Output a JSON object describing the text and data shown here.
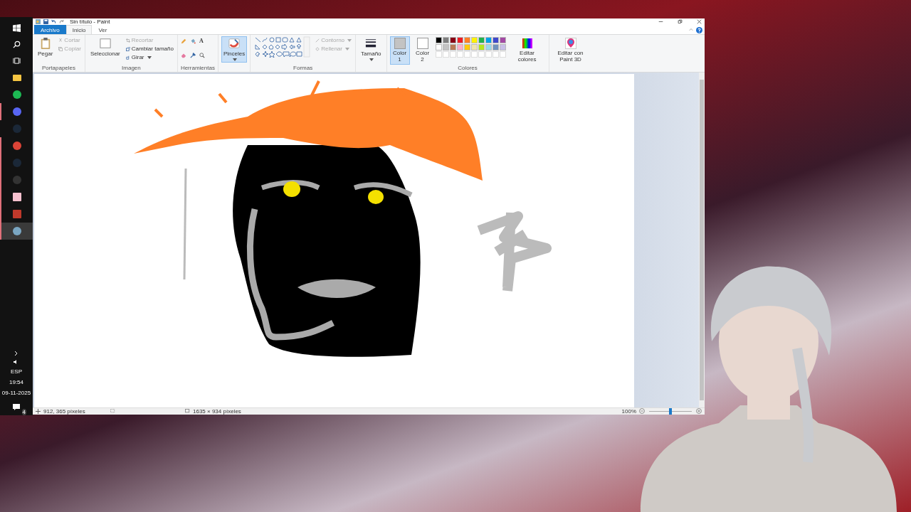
{
  "taskbar": {
    "apps": [
      {
        "kind": "folder",
        "running": false,
        "active": false
      },
      {
        "kind": "music",
        "running": false,
        "active": false
      },
      {
        "kind": "chat",
        "running": true,
        "active": false
      },
      {
        "kind": "game",
        "running": false,
        "active": false
      },
      {
        "kind": "browser",
        "running": true,
        "active": false
      },
      {
        "kind": "game",
        "running": true,
        "active": false
      },
      {
        "kind": "media",
        "running": true,
        "active": false
      },
      {
        "kind": "photo",
        "running": true,
        "active": false
      },
      {
        "kind": "video",
        "running": true,
        "active": false
      },
      {
        "kind": "paint",
        "running": true,
        "active": true
      }
    ],
    "language": "ESP",
    "time": "19:54",
    "date": "09-11-2025",
    "notifications": "4"
  },
  "window": {
    "title": "Sin título - Paint"
  },
  "tabs": [
    {
      "label": "Archivo",
      "kind": "file",
      "selected": false
    },
    {
      "label": "Inicio",
      "kind": "tab",
      "selected": true
    },
    {
      "label": "Ver",
      "kind": "tab",
      "selected": false
    }
  ],
  "ribbon": {
    "clipboard": {
      "label": "Portapapeles",
      "paste": "Pegar",
      "cut": {
        "label": "Cortar",
        "disabled": true
      },
      "copy": {
        "label": "Copiar",
        "disabled": true
      }
    },
    "image": {
      "label": "Imagen",
      "select": "Seleccionar",
      "crop": {
        "label": "Recortar",
        "disabled": true
      },
      "resize": {
        "label": "Cambiar tamaño",
        "disabled": false
      },
      "rotate": {
        "label": "Girar",
        "disabled": false
      }
    },
    "tools": {
      "label": "Herramientas",
      "text_tool": "A"
    },
    "brushes": {
      "label": "Pinceles",
      "selected": true
    },
    "shapes": {
      "label": "Formas",
      "outline": {
        "label": "Contorno",
        "disabled": true
      },
      "fill": {
        "label": "Rellenar",
        "disabled": true
      }
    },
    "size": {
      "label": "Tamaño"
    },
    "colors": {
      "label": "Colores",
      "color1": {
        "label": "Color",
        "index": "1",
        "color": "#c3c3c3",
        "selected": true
      },
      "color2": {
        "label": "Color",
        "index": "2",
        "color": "#ffffff",
        "selected": false
      },
      "palette": [
        {
          "color": "#000000"
        },
        {
          "color": "#7f7f7f"
        },
        {
          "color": "#880015"
        },
        {
          "color": "#ed1c24"
        },
        {
          "color": "#ff7f27"
        },
        {
          "color": "#fff200"
        },
        {
          "color": "#22b14c"
        },
        {
          "color": "#00a2e8"
        },
        {
          "color": "#3f48cc"
        },
        {
          "color": "#a349a4"
        },
        {
          "color": "#ffffff"
        },
        {
          "color": "#c3c3c3"
        },
        {
          "color": "#b97a57"
        },
        {
          "color": "#ffaec9"
        },
        {
          "color": "#ffc90e"
        },
        {
          "color": "#efe4b0"
        },
        {
          "color": "#b5e61d"
        },
        {
          "color": "#99d9ea"
        },
        {
          "color": "#7092be"
        },
        {
          "color": "#c8bfe7"
        }
      ],
      "edit_colors": "Editar colores",
      "paint3d": "Editar con Paint 3D"
    }
  },
  "status_bar": {
    "cursor": "912, 365 píxeles",
    "size": "1635 × 934 píxeles",
    "zoom": "100%",
    "zoom_level": {
      "level": 0.5
    }
  }
}
